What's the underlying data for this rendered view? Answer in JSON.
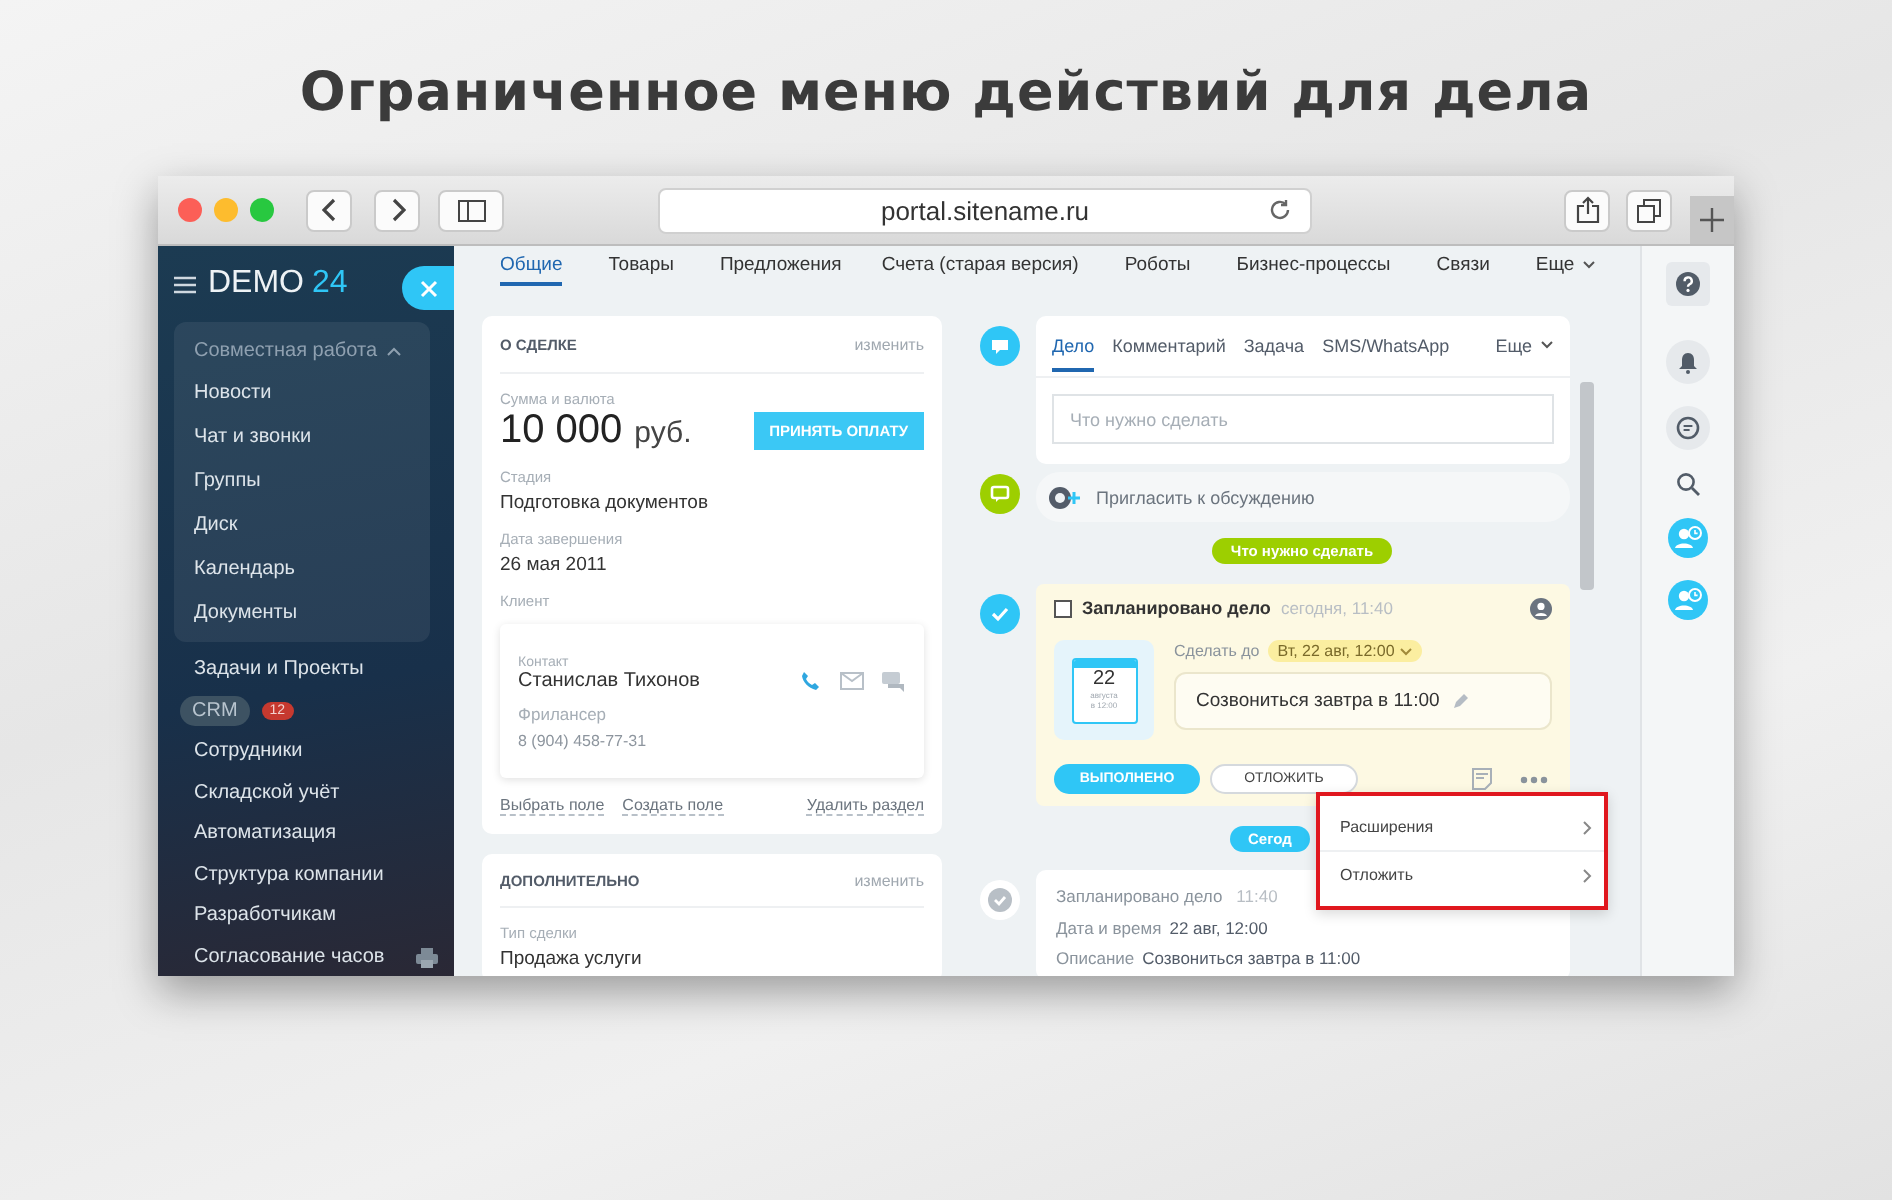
{
  "heading": "Ограниченное меню действий для дела",
  "browser": {
    "url": "portal.sitename.ru"
  },
  "sidebar": {
    "logo": "DEMO",
    "logo_number": "24",
    "group": {
      "label": "Совместная работа",
      "expanded": true,
      "items": [
        {
          "label": "Новости"
        },
        {
          "label": "Чат и звонки"
        },
        {
          "label": "Группы"
        },
        {
          "label": "Диск"
        },
        {
          "label": "Календарь"
        },
        {
          "label": "Документы"
        }
      ]
    },
    "items": [
      {
        "label": "Задачи и Проекты",
        "selected": false
      },
      {
        "label": "CRM",
        "selected": true,
        "badge": "12"
      },
      {
        "label": "Сотрудники",
        "selected": false
      },
      {
        "label": "Складской учёт",
        "selected": false
      },
      {
        "label": "Автоматизация",
        "selected": false
      },
      {
        "label": "Структура компании",
        "selected": false
      },
      {
        "label": "Разработчикам",
        "selected": false
      },
      {
        "label": "Согласование часов",
        "selected": false
      }
    ]
  },
  "tabs": [
    {
      "label": "Общие",
      "selected": true
    },
    {
      "label": "Товары",
      "selected": false
    },
    {
      "label": "Предложения",
      "selected": false
    },
    {
      "label": "Счета (старая версия)",
      "selected": false
    },
    {
      "label": "Роботы",
      "selected": false
    },
    {
      "label": "Бизнес-процессы",
      "selected": false
    },
    {
      "label": "Связи",
      "selected": false
    }
  ],
  "tabs_more": "Еще",
  "deal": {
    "title": "О СДЕЛКЕ",
    "edit": "изменить",
    "amount_label": "Сумма и валюта",
    "amount": "10 000",
    "currency": "руб.",
    "pay_button": "ПРИНЯТЬ ОПЛАТУ",
    "fields": [
      {
        "label": "Стадия",
        "value": "Подготовка документов"
      },
      {
        "label": "Дата завершения",
        "value": "26 мая 2011"
      }
    ],
    "client_label": "Клиент",
    "contact": {
      "label": "Контакт",
      "name": "Станислав Тихонов",
      "role": "Фрилансер",
      "phone": "8 (904) 458-77-31"
    },
    "links": [
      "Выбрать поле",
      "Создать поле",
      "Удалить раздел"
    ]
  },
  "extra": {
    "title": "ДОПОЛНИТЕЛЬНО",
    "edit": "изменить",
    "field_label": "Тип сделки",
    "field_value": "Продажа услуги"
  },
  "editor": {
    "tabs": [
      {
        "label": "Дело",
        "selected": true
      },
      {
        "label": "Комментарий",
        "selected": false
      },
      {
        "label": "Задача",
        "selected": false
      },
      {
        "label": "SMS/WhatsApp",
        "selected": false
      }
    ],
    "more": "Еще",
    "placeholder": "Что нужно сделать"
  },
  "invite": "Пригласить к обсуждению",
  "todo_pill": "Что нужно сделать",
  "activity": {
    "checked": false,
    "title": "Запланировано дело",
    "time": "сегодня, 11:40",
    "calendar_day": "22",
    "calendar_month": "августа",
    "calendar_time": "в 12:00",
    "due_label": "Сделать до",
    "due": "Вт, 22 авг, 12:00",
    "text": "Созвониться завтра в 11:00",
    "done_button": "ВЫПОЛНЕНО",
    "postpone_button": "ОТЛОЖИТЬ"
  },
  "today_pill": "Сегод",
  "menu": [
    {
      "label": "Расширения"
    },
    {
      "label": "Отложить"
    }
  ],
  "past": {
    "title": "Запланировано дело",
    "time": "11:40",
    "rows": [
      {
        "label": "Дата и время",
        "value": "22 авг, 12:00"
      },
      {
        "label": "Описание",
        "value": "Созвониться завтра в 11:00"
      }
    ]
  }
}
